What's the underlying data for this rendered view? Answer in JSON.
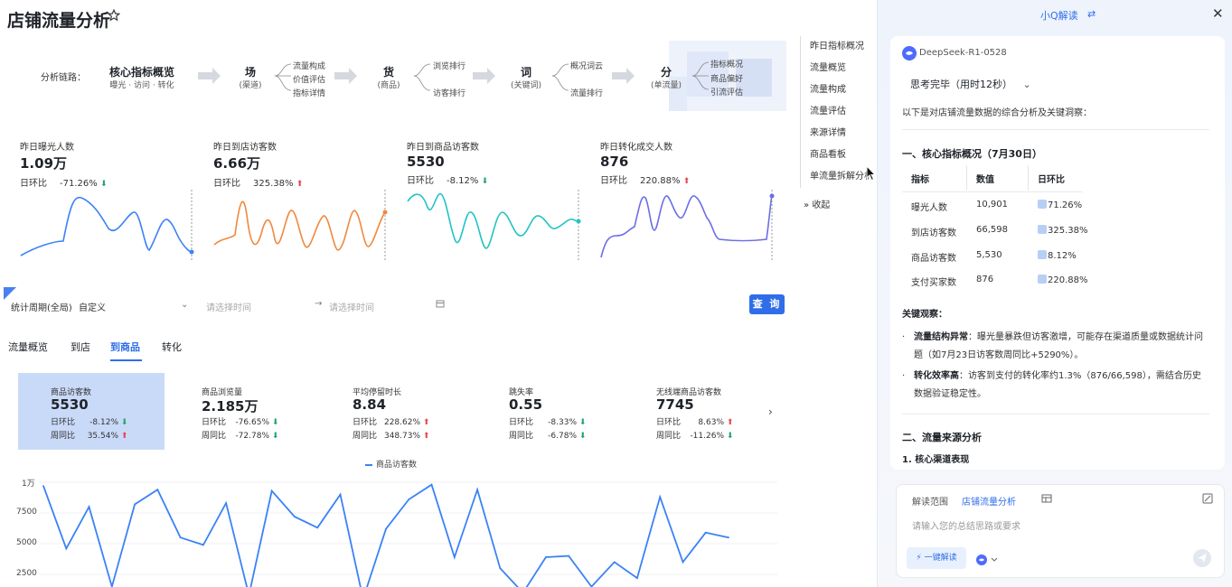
{
  "page": {
    "title": "店铺流量分析",
    "flow_label": "分析链路：",
    "flow": [
      {
        "main": "核心指标概览",
        "sub": "曝光 · 访问 · 转化"
      },
      {
        "main": "场",
        "sub": "(渠道)",
        "branches": [
          "流量构成",
          "价值评估",
          "指标详情"
        ]
      },
      {
        "main": "货",
        "sub": "(商品)",
        "branches": [
          "浏览排行",
          "访客排行"
        ]
      },
      {
        "main": "词",
        "sub": "(关键词)",
        "branches": [
          "概况词云",
          "流量排行"
        ]
      },
      {
        "main": "分",
        "sub": "(单流量)",
        "branches": [
          "指标概况",
          "商品偏好",
          "引流评估"
        ]
      }
    ],
    "side_menu": [
      "昨日指标概况",
      "流量概览",
      "流量构成",
      "流量评估",
      "来源详情",
      "商品看板",
      "单流量拆解分析"
    ],
    "collapse": "收起",
    "kpis": [
      {
        "title": "昨日曝光人数",
        "value": "1.09万",
        "label": "日环比",
        "pct": "-71.26%",
        "dir": "down",
        "color": "#3b82f6"
      },
      {
        "title": "昨日到店访客数",
        "value": "6.66万",
        "label": "日环比",
        "pct": "325.38%",
        "dir": "up",
        "color": "#f0883e"
      },
      {
        "title": "昨日到商品访客数",
        "value": "5530",
        "label": "日环比",
        "pct": "-8.12%",
        "dir": "down",
        "color": "#22c3c3"
      },
      {
        "title": "昨日转化成交人数",
        "value": "876",
        "label": "日环比",
        "pct": "220.88%",
        "dir": "up",
        "color": "#6b6ee6"
      }
    ],
    "filter": {
      "label": "统计周期(全局)",
      "value": "自定义",
      "start_placeholder": "请选择时间",
      "end_placeholder": "请选择时间",
      "query": "查 询"
    },
    "tabs": [
      "流量概览",
      "到店",
      "到商品",
      "转化"
    ],
    "metrics": [
      {
        "title": "商品访客数",
        "value": "5530",
        "r1l": "日环比",
        "r1": "-8.12%",
        "r1d": "down",
        "r2l": "周同比",
        "r2": "35.54%",
        "r2d": "up"
      },
      {
        "title": "商品浏览量",
        "value": "2.185万",
        "r1l": "日环比",
        "r1": "-76.65%",
        "r1d": "down",
        "r2l": "周同比",
        "r2": "-72.78%",
        "r2d": "down"
      },
      {
        "title": "平均停留时长",
        "value": "8.84",
        "r1l": "日环比",
        "r1": "228.62%",
        "r1d": "up",
        "r2l": "周同比",
        "r2": "348.73%",
        "r2d": "up"
      },
      {
        "title": "跳失率",
        "value": "0.55",
        "r1l": "日环比",
        "r1": "-8.33%",
        "r1d": "down",
        "r2l": "周同比",
        "r2": "-6.78%",
        "r2d": "down"
      },
      {
        "title": "无线端商品访客数",
        "value": "7745",
        "r1l": "日环比",
        "r1": "8.63%",
        "r1d": "up",
        "r2l": "周同比",
        "r2": "-11.26%",
        "r2d": "down"
      }
    ]
  },
  "chart_data": {
    "type": "line",
    "series": [
      {
        "name": "商品访客数",
        "values": [
          9700,
          4600,
          8000,
          1500,
          8200,
          9400,
          5500,
          4900,
          8300,
          800,
          9300,
          7200,
          6300,
          9000,
          500,
          6200,
          8600,
          9800,
          3900,
          9400,
          3000,
          1000,
          3900,
          4000,
          1500,
          3500,
          2200,
          8800,
          3500,
          5900,
          5500
        ]
      }
    ],
    "y_ticks": [
      "1万",
      "7500",
      "5000",
      "2500"
    ],
    "ylim": [
      0,
      10000
    ]
  },
  "panel": {
    "title": "小Q解读",
    "model": "DeepSeek-R1-0528",
    "think": "思考完毕（用时12秒）",
    "intro": "以下是对店铺流量数据的综合分析及关键洞察：",
    "section1": "一、核心指标概况（7月30日）",
    "table_headers": [
      "指标",
      "数值",
      "日环比"
    ],
    "table_rows": [
      [
        "曝光人数",
        "10,901",
        "71.26%"
      ],
      [
        "到店访客数",
        "66,598",
        "325.38%"
      ],
      [
        "商品访客数",
        "5,530",
        "8.12%"
      ],
      [
        "支付买家数",
        "876",
        "220.88%"
      ]
    ],
    "obs_title": "关键观察：",
    "obs": [
      {
        "bold": "流量结构异常",
        "text": "：曝光量暴跌但访客激增，可能存在渠道质量或数据统计问题（如7月23日访客数周同比+5290%）。"
      },
      {
        "bold": "转化效率高",
        "text": "：访客到支付的转化率约1.3%（876/66,598），需结合历史数据验证稳定性。"
      }
    ],
    "section2": "二、流量来源分析",
    "section2_sub": "1. 核心渠道表现",
    "scope_label": "解读范围",
    "scope_value": "店铺流量分析",
    "placeholder": "请输入您的总结思路或要求",
    "go_button": "一键解读"
  }
}
